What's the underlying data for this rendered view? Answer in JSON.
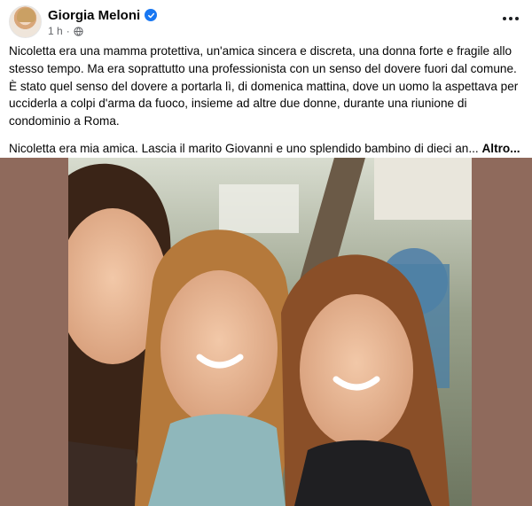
{
  "post": {
    "author_name": "Giorgia Meloni",
    "time": "1 h",
    "separator": "·",
    "paragraph1": "Nicoletta era una mamma protettiva, un'amica sincera e discreta, una donna forte e fragile allo stesso tempo. Ma era soprattutto una professionista con un senso del dovere fuori dal comune. È stato quel senso del dovere a portarla lì, di domenica mattina, dove un uomo la aspettava per ucciderla a colpi d'arma da fuoco, insieme ad altre due donne, durante una riunione di condominio a Roma.",
    "paragraph2": "Nicoletta era mia amica. Lascia il marito Giovanni e uno splendido bambino di dieci an...",
    "see_more": "Altro...",
    "colors": {
      "verified": "#1877f2",
      "meta": "#65676b",
      "media_bg": "#8f6a5c"
    },
    "icons": [
      "verified-badge-icon",
      "globe-icon",
      "more-options-icon"
    ]
  }
}
